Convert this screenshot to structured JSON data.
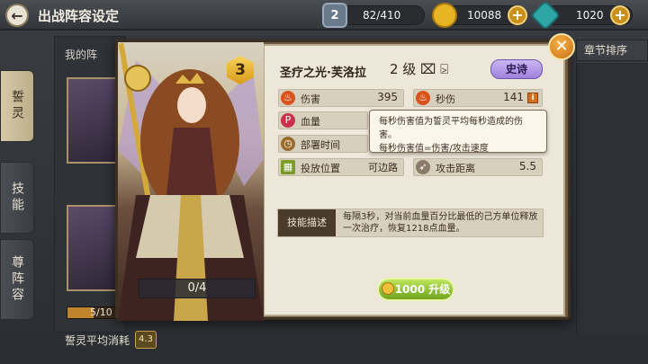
{
  "header": {
    "back_glyph": "←",
    "title": "出战阵容设定",
    "resources": [
      {
        "icon": "level-shield-icon",
        "icon_text": "2",
        "value": "82/410",
        "color": "#6a7a8c"
      },
      {
        "icon": "gold-coin-icon",
        "icon_text": "",
        "value": "10088",
        "color": "#e8b423"
      },
      {
        "icon": "gem-icon",
        "icon_text": "",
        "value": "1020",
        "color": "#2fa6a6"
      }
    ],
    "plus_glyph": "+"
  },
  "sidebar": {
    "tabs": [
      {
        "label": "誓灵",
        "active": true
      },
      {
        "label": "技能",
        "active": false
      },
      {
        "label": "尊阵容",
        "active": false
      }
    ]
  },
  "background": {
    "my_label": "我的阵",
    "progress_text": "5/10",
    "progress_fraction": 0.5,
    "avg_cost_label": "誓灵平均消耗",
    "avg_cost_value": "4.3",
    "chapter_sort": "章节排序"
  },
  "card": {
    "level": "3",
    "count": "0/4",
    "close_glyph": "✕"
  },
  "hero": {
    "name": "圣疗之光·芙洛拉",
    "level_text": "2 级 ⌧ ⍄",
    "rarity": "史诗"
  },
  "stats": {
    "damage": {
      "label": "伤害",
      "value": "395"
    },
    "dps": {
      "label": "秒伤",
      "value": "141"
    },
    "hp": {
      "label": "血量",
      "value": ""
    },
    "deploy": {
      "label": "部署时间",
      "value": ""
    },
    "position": {
      "label": "投放位置",
      "value": "可边路"
    },
    "range": {
      "label": "攻击距离",
      "value": "5.5"
    }
  },
  "tooltip": {
    "line1": "每秒伤害值为誓灵平均每秒造成的伤害。",
    "line2": "每秒伤害值=伤害/攻击速度"
  },
  "skill": {
    "label": "技能描述",
    "text": "每隔3秒，对当前血量百分比最低的己方单位释放一次治疗，恢复1218点血量。"
  },
  "upgrade": {
    "label": "1000 升级"
  },
  "colors": {
    "dialog_bg": "#6d5a44",
    "panel_bg": "#ede7da",
    "accent_gold": "#e8b423",
    "rarity_purple": "#a98be0",
    "upgrade_green": "#8dc23a"
  }
}
